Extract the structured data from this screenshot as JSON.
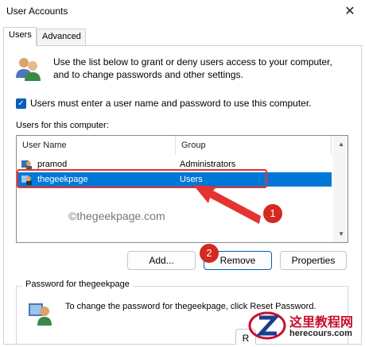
{
  "window": {
    "title": "User Accounts",
    "close_glyph": "✕"
  },
  "tabs": [
    {
      "label": "Users",
      "active": true
    },
    {
      "label": "Advanced",
      "active": false
    }
  ],
  "intro": {
    "text": "Use the list below to grant or deny users access to your computer, and to change passwords and other settings.",
    "icon": "users-group-icon"
  },
  "require_login": {
    "checked": true,
    "label": "Users must enter a user name and password to use this computer."
  },
  "users_list": {
    "label": "Users for this computer:",
    "columns": [
      "User Name",
      "Group"
    ],
    "rows": [
      {
        "name": "pramod",
        "group": "Administrators",
        "selected": false
      },
      {
        "name": "thegeekpage",
        "group": "Users",
        "selected": true
      }
    ]
  },
  "watermark": "©thegeekpage.com",
  "annotations": {
    "badge_1": "1",
    "badge_2": "2",
    "accent": "#e63232"
  },
  "buttons": {
    "add": "Add...",
    "remove": "Remove",
    "properties": "Properties",
    "reset_partial": "R"
  },
  "password_group": {
    "title": "Password for thegeekpage",
    "text": "To change the password for thegeekpage, click Reset Password."
  },
  "logo": {
    "cn": "这里教程网",
    "en": "herecours.com"
  },
  "colors": {
    "selection": "#0078d7",
    "accent": "#005fb8",
    "marker": "#d42a1f"
  }
}
